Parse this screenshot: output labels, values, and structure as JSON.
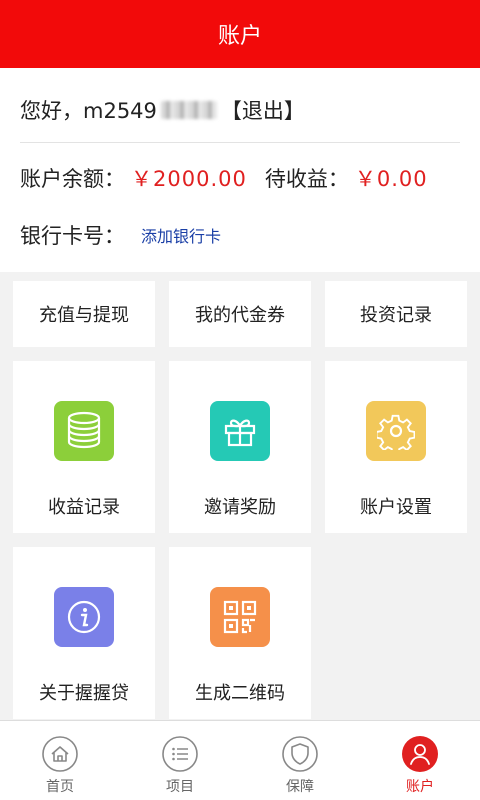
{
  "header": {
    "title": "账户"
  },
  "account": {
    "greeting": "您好，m2549",
    "logout": "【退出】",
    "balance_label": "账户余额：",
    "balance_value": "￥2000.00",
    "pending_label": "待收益：",
    "pending_value": "￥0.00",
    "bank_label": "银行卡号：",
    "add_card": "添加银行卡"
  },
  "quick_actions": [
    {
      "label": "充值与提现"
    },
    {
      "label": "我的代金券"
    },
    {
      "label": "投资记录"
    }
  ],
  "features": [
    {
      "label": "收益记录",
      "icon": "coins-icon",
      "color": "#8ccf3a"
    },
    {
      "label": "邀请奖励",
      "icon": "gift-icon",
      "color": "#25c9b5"
    },
    {
      "label": "账户设置",
      "icon": "gear-icon",
      "color": "#f2c85a"
    },
    {
      "label": "关于握握贷",
      "icon": "info-icon",
      "color": "#7a80e8"
    },
    {
      "label": "生成二维码",
      "icon": "qrcode-icon",
      "color": "#f5904a"
    }
  ],
  "tabs": [
    {
      "label": "首页",
      "icon": "home-icon"
    },
    {
      "label": "项目",
      "icon": "list-icon"
    },
    {
      "label": "保障",
      "icon": "shield-icon"
    },
    {
      "label": "账户",
      "icon": "user-icon",
      "active": true
    }
  ],
  "colors": {
    "brand_red": "#f20a0a",
    "money_red": "#e02020",
    "link_blue": "#1a3fa6"
  }
}
